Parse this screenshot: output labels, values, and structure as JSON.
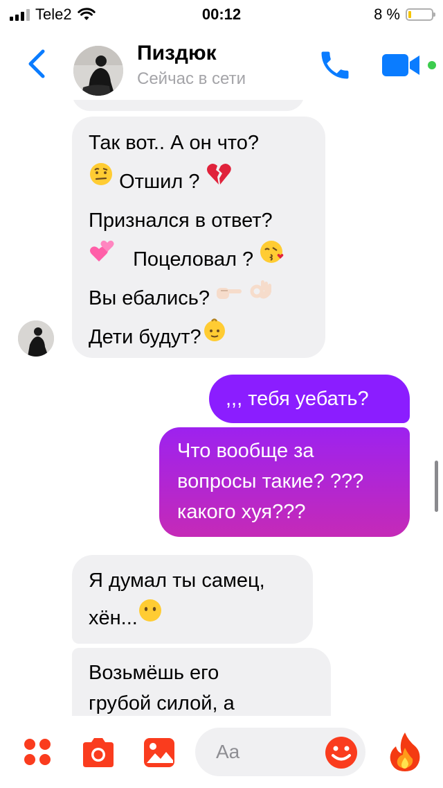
{
  "status_bar": {
    "carrier": "Tele2",
    "time": "00:12",
    "battery_percent": "8 %",
    "battery_level": 0.08,
    "icons": [
      "signal-icon",
      "wifi-icon",
      "battery-icon"
    ]
  },
  "header": {
    "contact_name": "Пиздюк",
    "status": "Сейчас в сети",
    "icons": [
      "back-chevron-icon",
      "phone-icon",
      "video-camera-icon"
    ],
    "accent_color": "#0a7cff",
    "online_color": "#3ccc4e"
  },
  "messages": {
    "m1": {
      "sender": "contact",
      "lines": [
        "Так вот.. А он что?",
        "Отшил ?",
        "Признался в ответ?",
        "Поцеловал ?",
        "Вы ебались?",
        "Дети будут?"
      ],
      "emojis": [
        "face-with-raised-eyebrow",
        "broken-heart",
        "two-hearts",
        "kissing-face",
        "pointing-right",
        "ok-hand",
        "baby"
      ]
    },
    "m2": {
      "sender": "me",
      "lines": [
        ",,, тебя уебать?"
      ]
    },
    "m3": {
      "sender": "me",
      "lines": [
        "Что вообще за",
        "вопросы такие? ???",
        "какого хуя???"
      ]
    },
    "m4": {
      "sender": "contact",
      "lines": [
        "Я думал ты самец,",
        "хён..."
      ],
      "emojis": [
        "face-without-mouth"
      ]
    },
    "m5": {
      "sender": "contact",
      "lines": [
        "Возьмёшь его",
        "грубой силой, а"
      ]
    }
  },
  "colors": {
    "incoming_bubble": "#f0f0f2",
    "outgoing_gradient_top": "#8b1dff",
    "outgoing_gradient_bottom": "#c52ab7",
    "composer_accent": "#fa3c1e"
  },
  "composer": {
    "placeholder": "Aa",
    "icons": [
      "menu-dots-icon",
      "camera-icon",
      "photo-gallery-icon",
      "emoji-smile-icon",
      "fire-emoji-icon"
    ]
  }
}
